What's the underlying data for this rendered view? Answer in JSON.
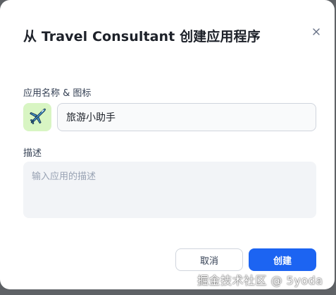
{
  "dialog": {
    "title": "从 Travel Consultant 创建应用程序",
    "close_icon": "close-icon"
  },
  "form": {
    "name_label": "应用名称 & 图标",
    "app_icon": "airplane-icon",
    "app_icon_bg": "#d8f5c3",
    "name_value": "旅游小助手",
    "desc_label": "描述",
    "desc_placeholder": "输入应用的描述",
    "desc_value": ""
  },
  "footer": {
    "cancel_label": "取消",
    "create_label": "创建",
    "primary_color": "#1c64f2"
  },
  "watermark": {
    "text": "掘金技术社区 @ 5yoda"
  }
}
